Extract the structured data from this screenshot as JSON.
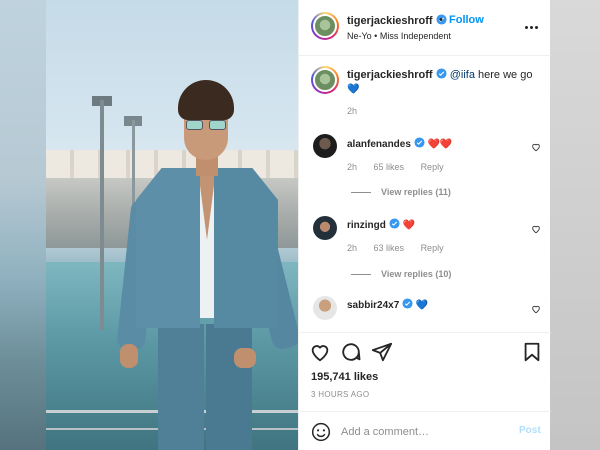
{
  "header": {
    "username": "tigerjackieshroff",
    "follow_label": "Follow",
    "separator": "•",
    "audio": "Ne-Yo • Miss Independent"
  },
  "caption": {
    "username": "tigerjackieshroff",
    "mention": "@iifa",
    "text": " here we go",
    "emoji": "💙",
    "time": "2h"
  },
  "comments": [
    {
      "username": "alanfenandes",
      "emoji": "❤️❤️",
      "time": "2h",
      "likes": "65 likes",
      "reply": "Reply",
      "view_replies": "View replies (11)"
    },
    {
      "username": "rinzingd",
      "emoji": "❤️",
      "time": "2h",
      "likes": "63 likes",
      "reply": "Reply",
      "view_replies": "View replies (10)"
    },
    {
      "username": "sabbir24x7",
      "emoji": "💙"
    }
  ],
  "stats": {
    "likes": "195,741 likes",
    "date": "3 HOURS AGO"
  },
  "comment_box": {
    "placeholder": "Add a comment…",
    "post_label": "Post"
  },
  "icons": [
    "verified-icon",
    "more-icon",
    "heart-icon",
    "comment-icon",
    "share-icon",
    "bookmark-icon",
    "emoji-icon",
    "mute-icon"
  ],
  "colors": {
    "accent": "#0095f6",
    "text": "#262626",
    "muted": "#8e8e8e"
  }
}
